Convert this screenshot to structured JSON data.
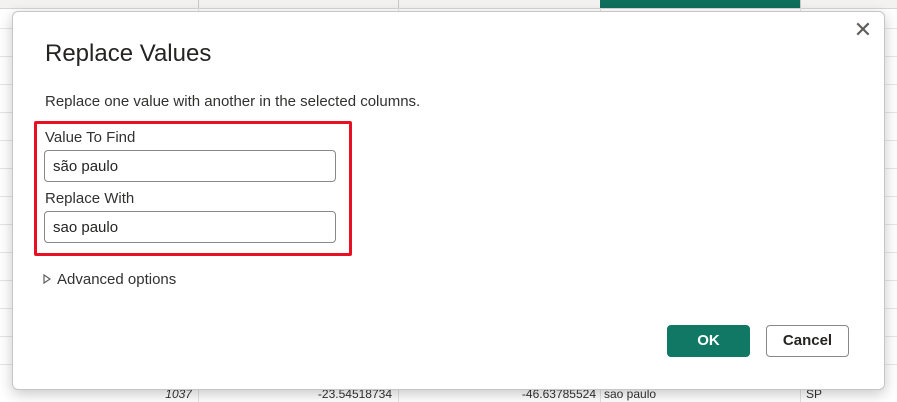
{
  "dialog": {
    "title": "Replace Values",
    "description": "Replace one value with another in the selected columns.",
    "close_glyph": "✕",
    "value_to_find": {
      "label": "Value To Find",
      "value": "são paulo"
    },
    "replace_with": {
      "label": "Replace With",
      "value": "sao paulo"
    },
    "advanced_options_label": "Advanced options",
    "ok_label": "OK",
    "cancel_label": "Cancel"
  },
  "background_row": {
    "cells": [
      "1037",
      "-23.54518734",
      "-46.63785524",
      "sao paulo",
      "SP"
    ]
  },
  "colors": {
    "accent": "#117865",
    "highlight": "#e81123",
    "selected_column": "#106e5d"
  },
  "icons": [
    "close-icon",
    "caret-right-icon"
  ]
}
